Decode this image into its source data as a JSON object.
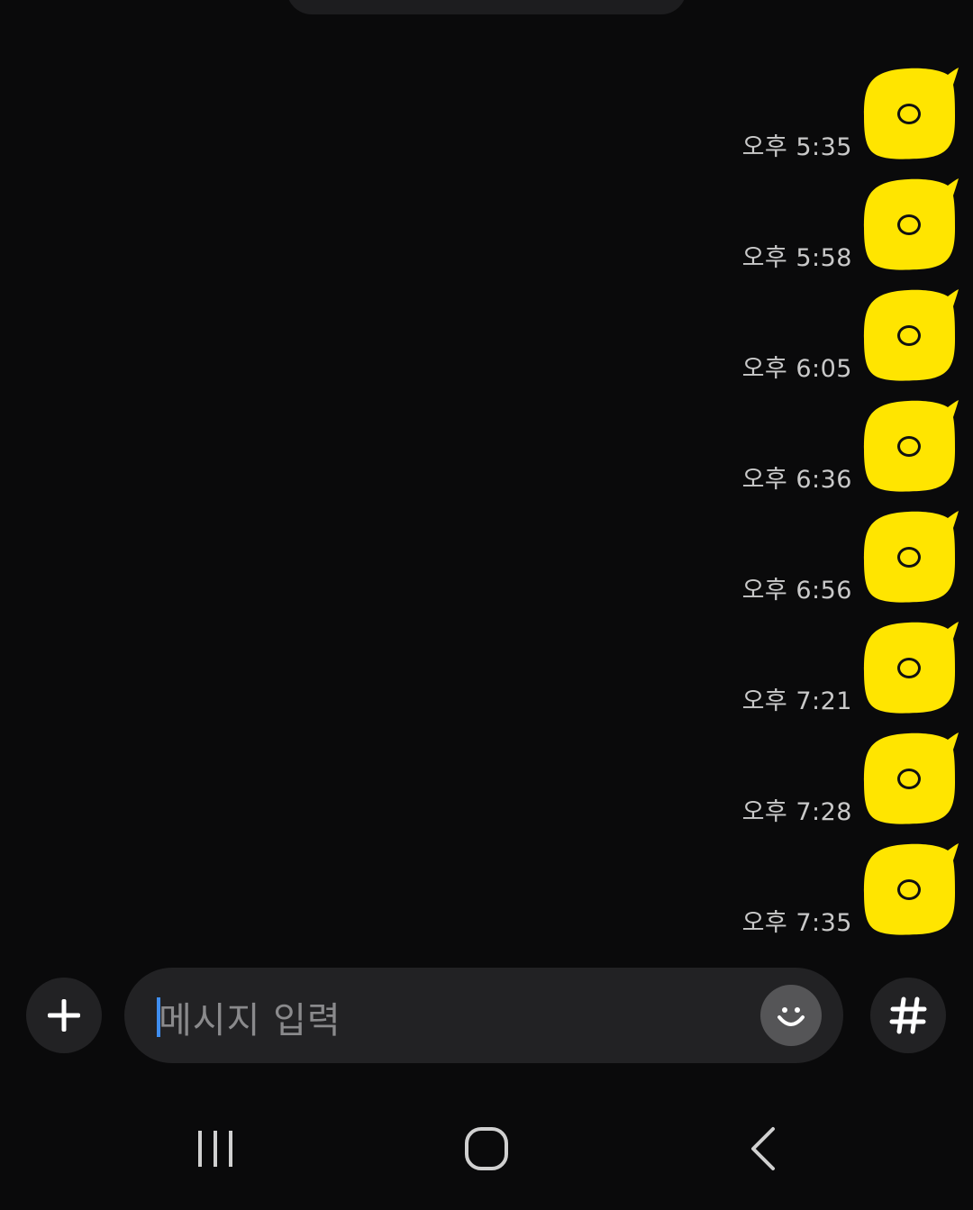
{
  "messages": [
    {
      "text": "ㅇ",
      "time": "오후 5:35"
    },
    {
      "text": "ㅇ",
      "time": "오후 5:58"
    },
    {
      "text": "ㅇ",
      "time": "오후 6:05"
    },
    {
      "text": "ㅇ",
      "time": "오후 6:36"
    },
    {
      "text": "ㅇ",
      "time": "오후 6:56"
    },
    {
      "text": "ㅇ",
      "time": "오후 7:21"
    },
    {
      "text": "ㅇ",
      "time": "오후 7:28"
    },
    {
      "text": "ㅇ",
      "time": "오후 7:35"
    }
  ],
  "input": {
    "placeholder": "메시지 입력",
    "value": ""
  },
  "icons": {
    "attach": "plus-icon",
    "emoji": "smile-icon",
    "hashtag": "hash-icon",
    "nav_recents": "recents-icon",
    "nav_home": "home-icon",
    "nav_back": "back-icon"
  },
  "colors": {
    "background": "#0a0a0b",
    "bubble": "#ffe500",
    "time_text": "#c9c9c9",
    "input_bg": "#222224",
    "caret": "#3f8ef0"
  }
}
